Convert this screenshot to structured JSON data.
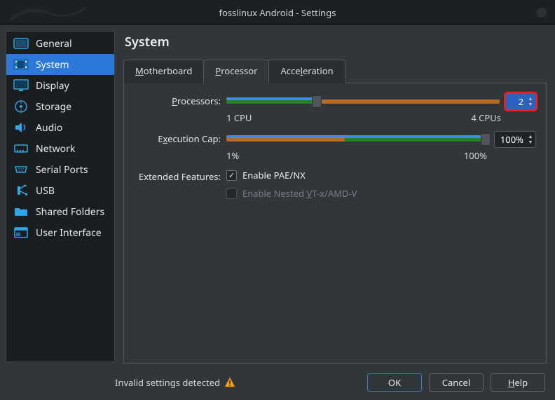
{
  "window": {
    "title": "fosslinux Android - Settings"
  },
  "page": {
    "title": "System"
  },
  "sidebar": {
    "items": [
      {
        "icon": "general",
        "label": "General"
      },
      {
        "icon": "system",
        "label": "System"
      },
      {
        "icon": "display",
        "label": "Display"
      },
      {
        "icon": "storage",
        "label": "Storage"
      },
      {
        "icon": "audio",
        "label": "Audio"
      },
      {
        "icon": "network",
        "label": "Network"
      },
      {
        "icon": "serial",
        "label": "Serial Ports"
      },
      {
        "icon": "usb",
        "label": "USB"
      },
      {
        "icon": "folders",
        "label": "Shared Folders"
      },
      {
        "icon": "ui",
        "label": "User Interface"
      }
    ],
    "active_index": 1
  },
  "tabs": {
    "items": [
      {
        "label_pre": "",
        "mnemonic": "M",
        "label_post": "otherboard"
      },
      {
        "label_pre": "",
        "mnemonic": "P",
        "label_post": "rocessor"
      },
      {
        "label_pre": "Acce",
        "mnemonic": "l",
        "label_post": "eration"
      }
    ],
    "active_index": 1
  },
  "processor": {
    "processors_label_pre": "",
    "processors_mnemonic": "P",
    "processors_label_post": "rocessors:",
    "cpu_min_label": "1 CPU",
    "cpu_max_label": "4 CPUs",
    "cpu_value": "2",
    "exec_label_pre": "E",
    "exec_mnemonic": "x",
    "exec_label_post": "ecution Cap:",
    "exec_min_label": "1%",
    "exec_max_label": "100%",
    "exec_value": "100%",
    "features_label": "Extended Features:",
    "pae_label": "Enable PAE/NX",
    "pae_checked": true,
    "nested_label_pre": "Enable Nested ",
    "nested_mnemonic": "V",
    "nested_label_post": "T-x/AMD-V",
    "nested_checked": false,
    "nested_enabled": false
  },
  "footer": {
    "invalid_msg": "Invalid settings detected",
    "ok": "OK",
    "cancel": "Cancel",
    "help_mnemonic": "H",
    "help_post": "elp"
  }
}
